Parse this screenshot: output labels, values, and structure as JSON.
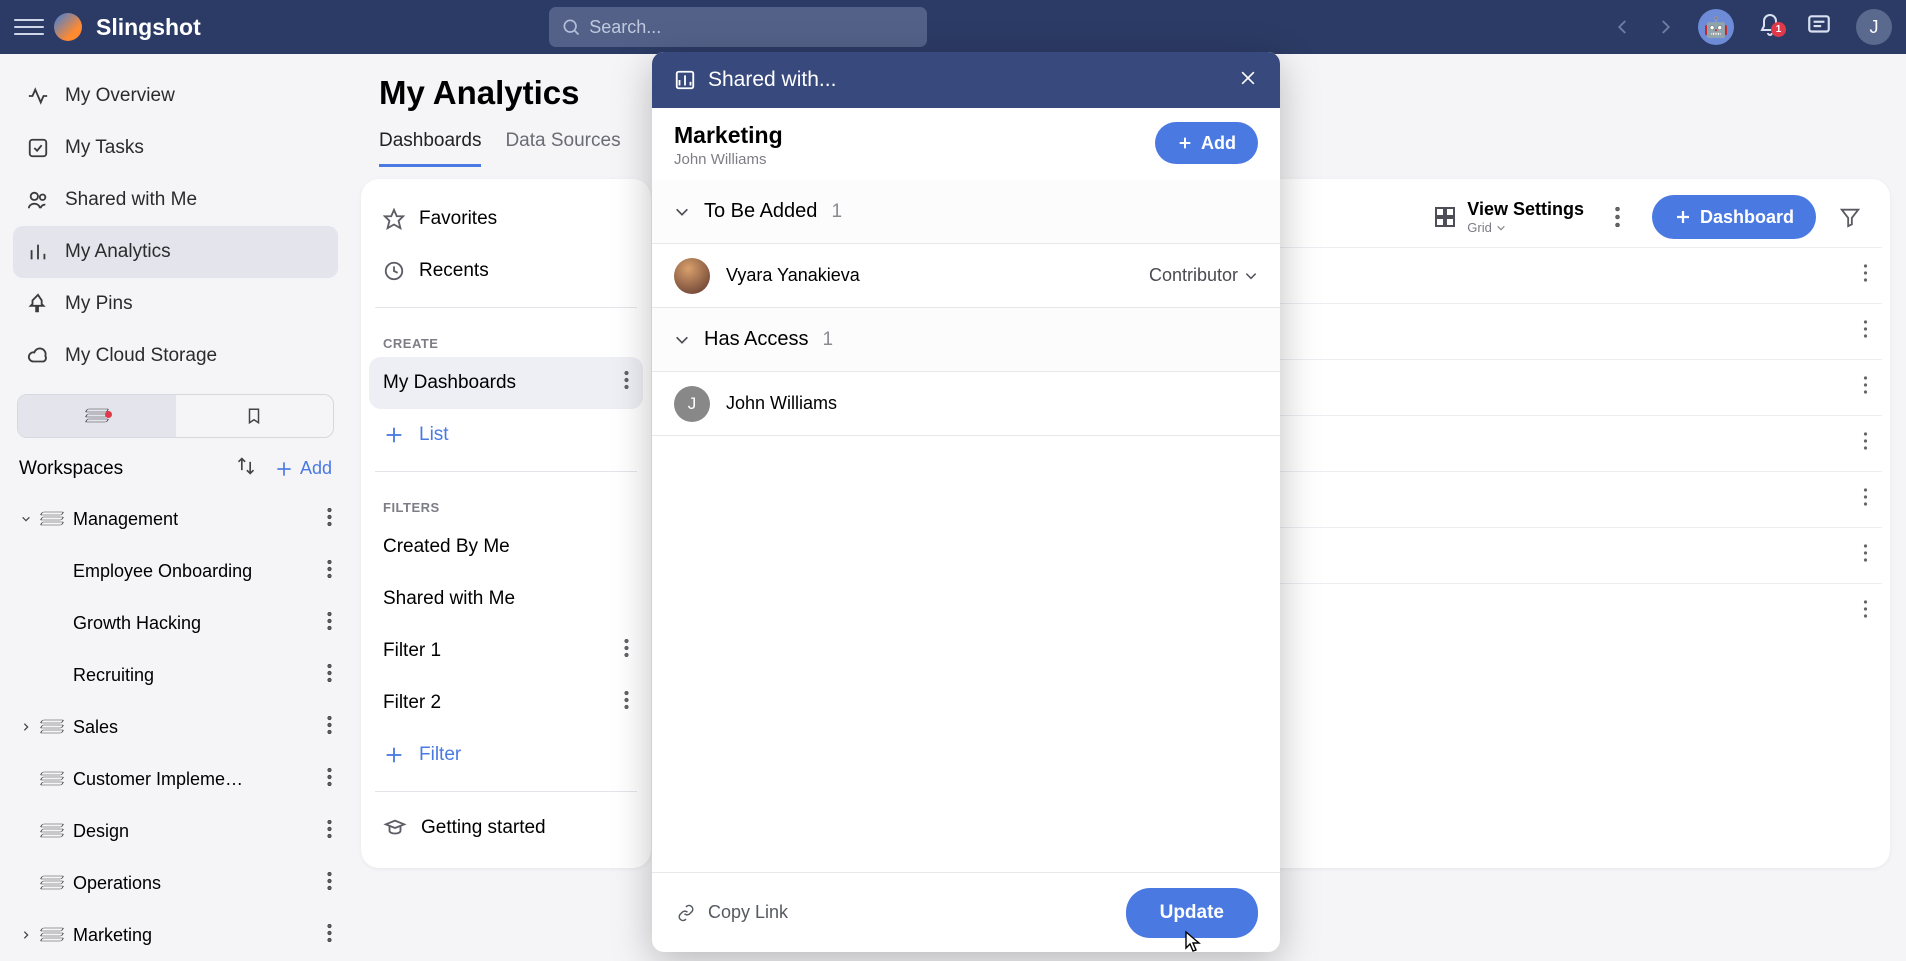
{
  "brand": "Slingshot",
  "search": {
    "placeholder": "Search..."
  },
  "notifications": {
    "count": "1"
  },
  "user_initial": "J",
  "nav": {
    "overview": "My Overview",
    "tasks": "My Tasks",
    "shared": "Shared with Me",
    "analytics": "My Analytics",
    "pins": "My Pins",
    "cloud": "My Cloud Storage"
  },
  "ws": {
    "title": "Workspaces",
    "add": "Add",
    "items": {
      "management": "Management",
      "emp_onboarding": "Employee Onboarding",
      "growth": "Growth Hacking",
      "recruiting": "Recruiting",
      "sales": "Sales",
      "customer_impl": "Customer Implementa…",
      "design": "Design",
      "operations": "Operations",
      "marketing": "Marketing"
    }
  },
  "page": {
    "title": "My Analytics",
    "tabs": {
      "dashboards": "Dashboards",
      "datasources": "Data Sources"
    }
  },
  "panel": {
    "favorites": "Favorites",
    "recents": "Recents",
    "create_label": "CREATE",
    "my_dashboards": "My Dashboards",
    "list": "List",
    "filters_label": "FILTERS",
    "created_by_me": "Created By Me",
    "shared_with_me": "Shared with Me",
    "filter1": "Filter 1",
    "filter2": "Filter 2",
    "filter_add": "Filter",
    "getting_started": "Getting started"
  },
  "viewbar": {
    "view_settings": "View Settings",
    "grid": "Grid",
    "dashboard_btn": "Dashboard"
  },
  "modal": {
    "title": "Shared with...",
    "item_title": "Marketing",
    "item_owner": "John Williams",
    "add": "Add",
    "group_to_be_added": {
      "label": "To Be Added",
      "count": "1"
    },
    "to_be_added_member": {
      "name": "Vyara Yanakieva",
      "role": "Contributor"
    },
    "group_has_access": {
      "label": "Has Access",
      "count": "1"
    },
    "has_access_member": {
      "name": "John Williams",
      "initial": "J"
    },
    "copy_link": "Copy Link",
    "update": "Update"
  }
}
